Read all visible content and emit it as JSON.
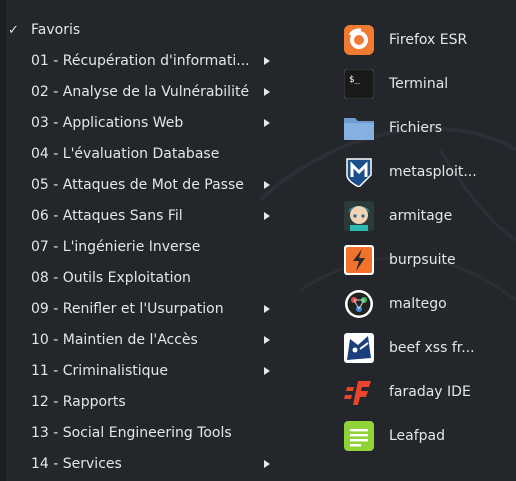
{
  "menu": {
    "items": [
      {
        "label": "Favoris",
        "checked": true,
        "submenu": false
      },
      {
        "label": "01 - Récupération d'informati...",
        "submenu": true
      },
      {
        "label": "02 - Analyse de la Vulnérabilité",
        "submenu": true
      },
      {
        "label": "03 - Applications Web",
        "submenu": true
      },
      {
        "label": "04 - L'évaluation Database",
        "submenu": false
      },
      {
        "label": "05 - Attaques de Mot de Passe",
        "submenu": true
      },
      {
        "label": "06 - Attaques Sans Fil",
        "submenu": true
      },
      {
        "label": "07 - L'ingénierie Inverse",
        "submenu": false
      },
      {
        "label": "08 - Outils Exploitation",
        "submenu": false
      },
      {
        "label": "09 - Renifler et l'Usurpation",
        "submenu": true
      },
      {
        "label": "10 - Maintien de l'Accès",
        "submenu": true
      },
      {
        "label": "11 - Criminalistique",
        "submenu": true
      },
      {
        "label": "12 - Rapports",
        "submenu": false
      },
      {
        "label": "13 - Social Engineering Tools",
        "submenu": false
      },
      {
        "label": "14 - Services",
        "submenu": true
      }
    ],
    "check_glyph": "✓"
  },
  "apps": [
    {
      "label": "Firefox ESR",
      "icon": "firefox-icon"
    },
    {
      "label": "Terminal",
      "icon": "terminal-icon",
      "icon_text": "$_"
    },
    {
      "label": "Fichiers",
      "icon": "folder-icon"
    },
    {
      "label": "metasploit...",
      "icon": "metasploit-icon"
    },
    {
      "label": "armitage",
      "icon": "armitage-icon"
    },
    {
      "label": "burpsuite",
      "icon": "burpsuite-icon"
    },
    {
      "label": "maltego",
      "icon": "maltego-icon"
    },
    {
      "label": "beef xss fr...",
      "icon": "beef-icon"
    },
    {
      "label": "faraday IDE",
      "icon": "faraday-icon"
    },
    {
      "label": "Leafpad",
      "icon": "leafpad-icon"
    }
  ],
  "colors": {
    "background": "#23262b",
    "text": "#e6e6e6",
    "firefox": "#f07a32",
    "burp": "#f3722b",
    "faraday": "#e8452a",
    "leafpad": "#8fd23a",
    "folder": "#7da7d9"
  }
}
